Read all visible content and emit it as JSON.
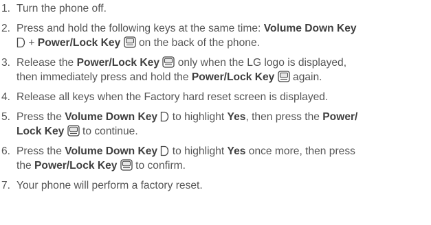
{
  "steps": [
    {
      "number": "1.",
      "line1": [
        "Turn the phone off."
      ]
    },
    {
      "number": "2.",
      "line1": [
        "Press and hold the following keys at the same time: ",
        "Volume Down Key"
      ],
      "line2": [
        "+ ",
        "Power/Lock Key",
        "on the back of the phone."
      ]
    },
    {
      "number": "3.",
      "line1": [
        "Release the ",
        "Power/Lock Key",
        "only when the LG logo is displayed,"
      ],
      "line2": [
        "then immediately press and hold the ",
        "Power/Lock Key",
        "again."
      ]
    },
    {
      "number": "4.",
      "line1": [
        "Release all keys when the Factory hard reset screen is displayed."
      ]
    },
    {
      "number": "5.",
      "line1": [
        "Press the ",
        "Volume Down Key",
        "to highlight ",
        "Yes",
        ", then press the ",
        "Power/"
      ],
      "line2": [
        "Lock Key",
        "to continue."
      ]
    },
    {
      "number": "6.",
      "line1": [
        "Press the ",
        "Volume Down Key",
        "to highlight ",
        "Yes",
        " once more, then press"
      ],
      "line2": [
        "the ",
        "Power/Lock Key",
        "to confirm."
      ]
    },
    {
      "number": "7.",
      "line1": [
        "Your phone will perform a factory reset."
      ]
    }
  ],
  "icons": {
    "volume_down_key": "volume-down-key-icon",
    "power_lock_key": "power-lock-key-icon"
  },
  "colors": {
    "text": "#555555",
    "emphasis": "#3f3f3f"
  }
}
